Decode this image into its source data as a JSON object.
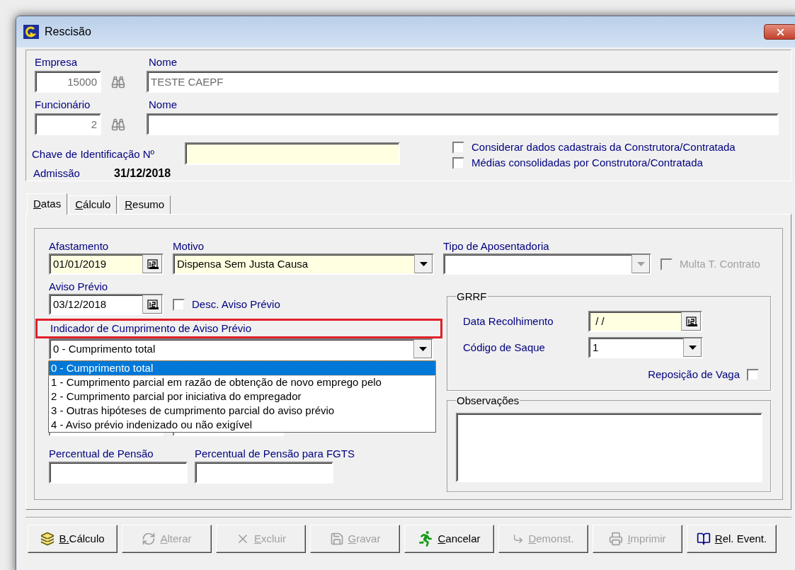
{
  "window": {
    "title": "Rescisão"
  },
  "header": {
    "empresa": {
      "label": "Empresa",
      "value": "15000"
    },
    "empresa_nome": {
      "label": "Nome",
      "value": "TESTE CAEPF"
    },
    "funcionario": {
      "label": "Funcionário",
      "value": "2"
    },
    "funcionario_nome": {
      "label": "Nome"
    },
    "chave": {
      "label": "Chave de Identificação Nº"
    },
    "options": [
      {
        "label": "Considerar dados cadastrais da Construtora/Contratada",
        "checked": false
      },
      {
        "label": "Médias consolidadas por Construtora/Contratada",
        "checked": false
      }
    ],
    "admissao": {
      "label": "Admissão",
      "value": "31/12/2018"
    }
  },
  "tabs": [
    {
      "label": "Datas",
      "selected": true
    },
    {
      "label": "Cálculo",
      "selected": false
    },
    {
      "label": "Resumo",
      "selected": false
    }
  ],
  "datas": {
    "afastamento": {
      "label": "Afastamento",
      "value": "01/01/2019"
    },
    "motivo": {
      "label": "Motivo",
      "value": "Dispensa Sem Justa Causa"
    },
    "tipo_aposentadoria": {
      "label": "Tipo de Aposentadoria",
      "disabled": true
    },
    "multa": {
      "label": "Multa T. Contrato",
      "checked": false,
      "disabled": true
    },
    "aviso_previo": {
      "label": "Aviso Prévio",
      "value": "03/12/2018"
    },
    "desc_aviso": {
      "label": "Desc. Aviso Prévio",
      "checked": false
    },
    "indicador": {
      "label": "Indicador de Cumprimento de Aviso Prévio",
      "highlighted": true,
      "value": "0 - Cumprimento total",
      "expanded": true,
      "options": [
        {
          "label": "0 - Cumprimento total",
          "selected": true
        },
        {
          "label": "1 - Cumprimento parcial em razão de obtenção de novo emprego pelo",
          "selected": false
        },
        {
          "label": "2 - Cumprimento parcial por iniciativa do empregador",
          "selected": false
        },
        {
          "label": "3 - Outras hipóteses de cumprimento parcial do aviso prévio",
          "selected": false
        },
        {
          "label": "4 - Aviso prévio indenizado ou não exigível",
          "selected": false
        }
      ]
    },
    "percentual_pensao": {
      "label": "Percentual de Pensão"
    },
    "percentual_fgts": {
      "label": "Percentual de Pensão para FGTS"
    }
  },
  "grrf": {
    "title": "GRRF",
    "data_recolhimento": {
      "label": "Data Recolhimento",
      "value": " / /"
    },
    "codigo_saque": {
      "label": "Código de Saque",
      "value": "1"
    },
    "reposicao": {
      "label": "Reposição de Vaga",
      "checked": false
    }
  },
  "observacoes": {
    "title": "Observações"
  },
  "buttons": [
    {
      "label": "B.Cálculo",
      "kind": "calc",
      "disabled": false
    },
    {
      "label": "Alterar",
      "kind": "edit",
      "disabled": true
    },
    {
      "label": "Excluir",
      "kind": "delete",
      "disabled": true
    },
    {
      "label": "Gravar",
      "kind": "save",
      "disabled": true
    },
    {
      "label": "Cancelar",
      "kind": "cancel",
      "disabled": false
    },
    {
      "label": "Demonst.",
      "kind": "demo",
      "disabled": true
    },
    {
      "label": "Imprimir",
      "kind": "print",
      "disabled": true
    },
    {
      "label": "Rel. Event.",
      "kind": "report",
      "disabled": false
    }
  ]
}
